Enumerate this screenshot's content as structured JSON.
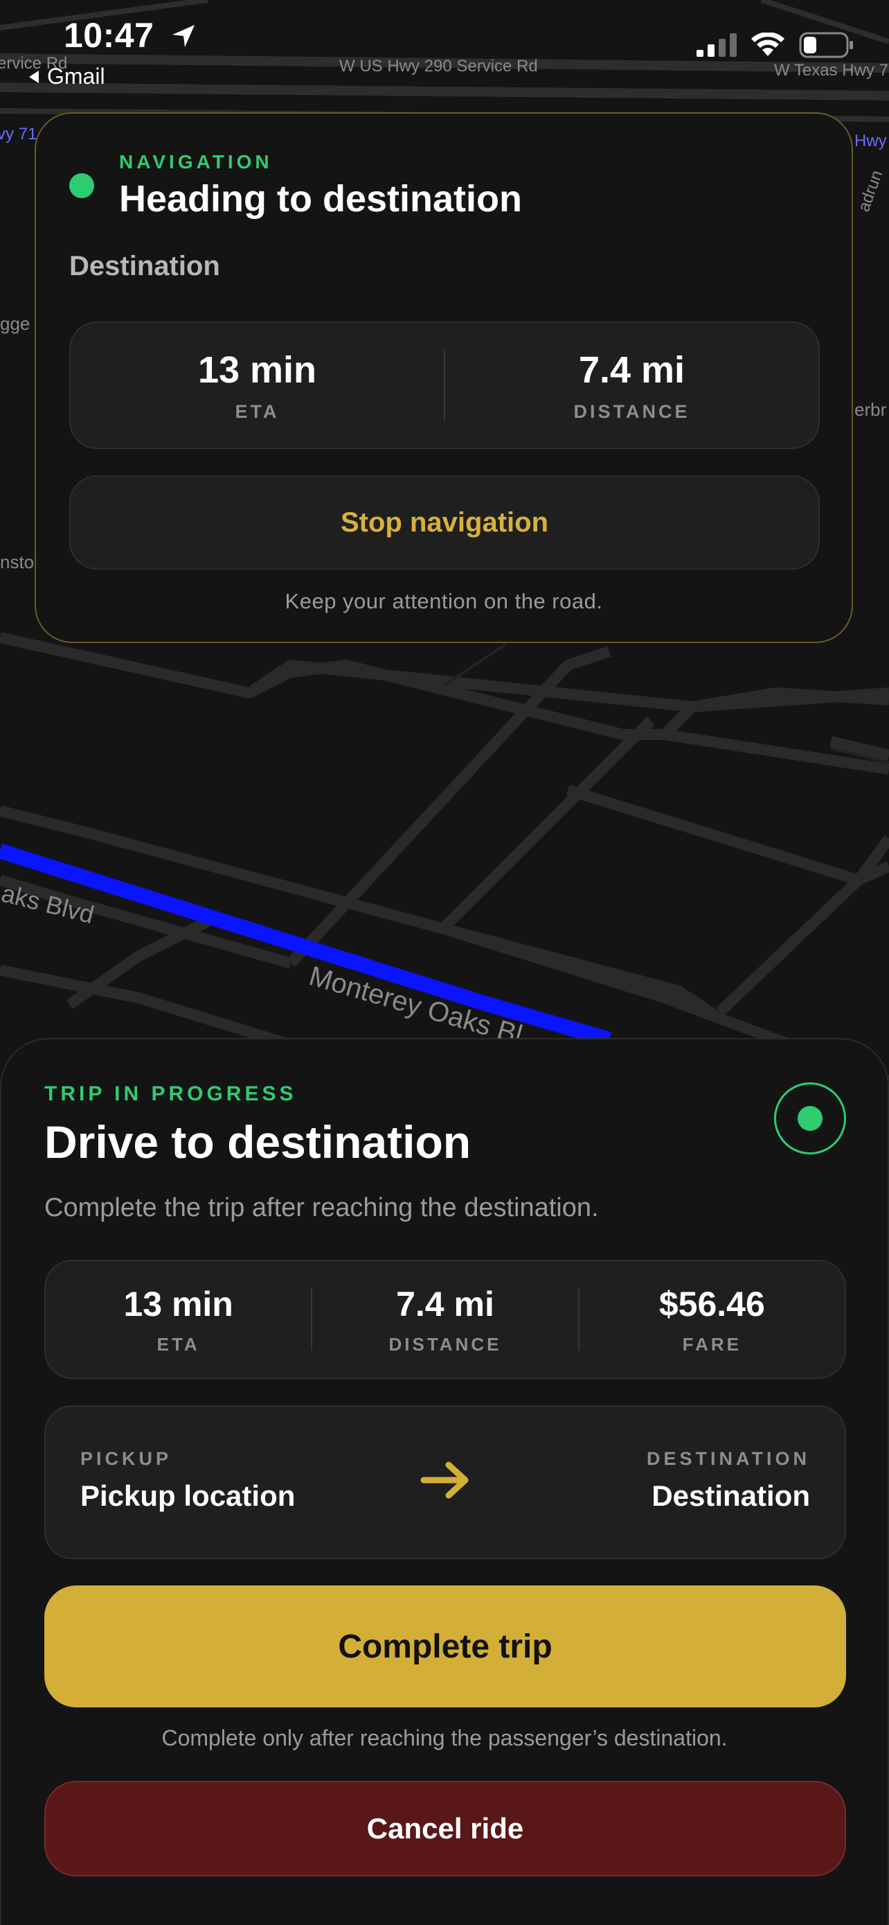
{
  "status_bar": {
    "time": "10:47",
    "back_app": "Gmail",
    "icons": [
      "location-arrow-icon",
      "signal-icon",
      "wifi-icon",
      "battery-icon"
    ]
  },
  "map": {
    "labels": {
      "service_rd_left": "ervice Rd",
      "hwy_290": "W US Hwy 290 Service Rd",
      "texas_hwy": "W Texas Hwy 7",
      "hwy_71_left": "vy 71",
      "hwy_right": "Hwy",
      "adrun": "adrun",
      "gge": "gge",
      "erbr": "erbr",
      "nsto": "nsto",
      "oaks_blvd": "aks Blvd",
      "monterey": "Monterey Oaks Bl"
    },
    "route_color": "#0a14ff"
  },
  "navigation": {
    "eyebrow": "NAVIGATION",
    "title": "Heading to destination",
    "subtitle": "Destination",
    "eta_value": "13 min",
    "eta_label": "ETA",
    "distance_value": "7.4 mi",
    "distance_label": "DISTANCE",
    "stop_label": "Stop navigation",
    "note": "Keep your attention on the road."
  },
  "trip": {
    "eyebrow": "TRIP IN PROGRESS",
    "title": "Drive to destination",
    "description": "Complete the trip after reaching the destination.",
    "eta_value": "13 min",
    "eta_label": "ETA",
    "distance_value": "7.4 mi",
    "distance_label": "DISTANCE",
    "fare_value": "$56.46",
    "fare_label": "FARE",
    "pickup_caption": "PICKUP",
    "pickup_name": "Pickup location",
    "destination_caption": "DESTINATION",
    "destination_name": "Destination",
    "complete_label": "Complete trip",
    "complete_note": "Complete only after reaching the passenger’s destination.",
    "cancel_label": "Cancel ride"
  },
  "colors": {
    "accent_green": "#2ecc71",
    "accent_gold": "#d4af37",
    "cancel_red": "#5a1717"
  }
}
